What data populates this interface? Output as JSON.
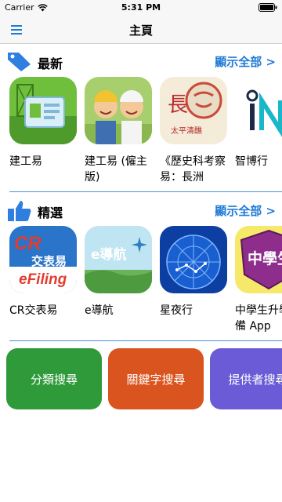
{
  "status_bar": {
    "carrier": "Carrier",
    "time": "5:31 PM"
  },
  "nav": {
    "title": "主頁",
    "menu_icon": "hamburger-menu-icon"
  },
  "sections": {
    "latest": {
      "title": "最新",
      "show_all": "顯示全部 >",
      "icon": "tag-icon"
    },
    "featured": {
      "title": "精選",
      "show_all": "顯示全部 >",
      "icon": "thumbs-up-icon"
    }
  },
  "latest_apps": [
    {
      "label": "建工易"
    },
    {
      "label": "建工易 (僱主版)"
    },
    {
      "label": "《歷史科考察易：長洲"
    },
    {
      "label": "智博行"
    }
  ],
  "featured_apps": [
    {
      "label": "CR交表易",
      "icon_text_1": "CR",
      "icon_text_2": "交表易",
      "icon_text_3": "eFiling"
    },
    {
      "label": "e導航",
      "icon_text_1": "e導航"
    },
    {
      "label": "星夜行"
    },
    {
      "label": "中學生升學必備 App",
      "icon_text_1": "中學生"
    }
  ],
  "latest_icon_texts": {
    "app3_top": "長",
    "app3_bottom": "太平清醮"
  },
  "search_buttons": [
    {
      "label": "分類搜尋",
      "color": "#2e9a3a"
    },
    {
      "label": "關鍵字搜尋",
      "color": "#d9541e"
    },
    {
      "label": "提供者搜尋",
      "color": "#6b5bd6"
    }
  ],
  "colors": {
    "accent": "#1f7ad6",
    "divider": "#4a90d9"
  }
}
